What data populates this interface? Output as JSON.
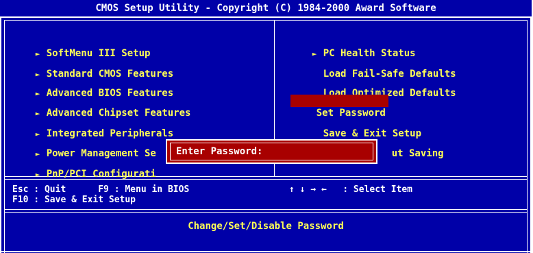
{
  "title": "CMOS Setup Utility - Copyright (C) 1984-2000 Award Software",
  "left_menu": [
    {
      "label": "SoftMenu III Setup",
      "arrow": "►"
    },
    {
      "label": "Standard CMOS Features",
      "arrow": "►"
    },
    {
      "label": "Advanced BIOS Features",
      "arrow": "►"
    },
    {
      "label": "Advanced Chipset Features",
      "arrow": "►"
    },
    {
      "label": "Integrated Peripherals",
      "arrow": "►"
    },
    {
      "label": "Power Management Se",
      "arrow": "►"
    },
    {
      "label": "PnP/PCI Configurati",
      "arrow": "►"
    }
  ],
  "right_menu": [
    {
      "label": "PC Health Status",
      "arrow": "►"
    },
    {
      "label": "Load Fail-Safe Defaults"
    },
    {
      "label": "Load Optimized Defaults"
    },
    {
      "label": "Set Password",
      "selected": true
    },
    {
      "label": "Save & Exit Setup"
    },
    {
      "label": "ut Saving"
    }
  ],
  "help": {
    "line1_left": "Esc : Quit      F9 : Menu in BIOS",
    "line1_right": "↑ ↓ → ←   : Select Item",
    "line2": "F10 : Save & Exit Setup"
  },
  "description": "Change/Set/Disable Password",
  "dialog": {
    "prompt": "Enter Password:"
  },
  "colors": {
    "background": "#0000a8",
    "menu_text": "#ffff55",
    "highlight": "#a80000",
    "frame": "#ffffff"
  }
}
